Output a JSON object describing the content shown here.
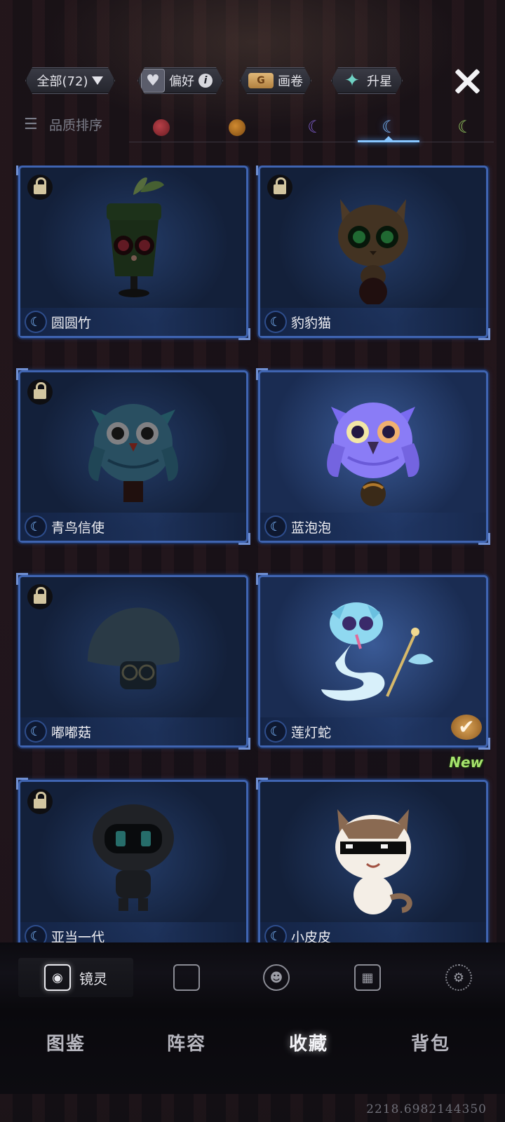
{
  "topbar": {
    "filter_label": "全部(72)",
    "preference_label": "偏好",
    "scroll_label": "画卷",
    "upgrade_label": "升星",
    "scroll_badge": "G",
    "info_badge": "i"
  },
  "quality": {
    "sort_label": "品质排序",
    "tiers": [
      "red",
      "orange",
      "purple",
      "blue",
      "green"
    ],
    "active_tier": "blue"
  },
  "cards": [
    {
      "name": "圆圆竹",
      "locked": true,
      "checked": false,
      "new": false
    },
    {
      "name": "豹豹猫",
      "locked": true,
      "checked": false,
      "new": false
    },
    {
      "name": "青鸟信使",
      "locked": true,
      "checked": false,
      "new": false
    },
    {
      "name": "蓝泡泡",
      "locked": false,
      "checked": false,
      "new": false
    },
    {
      "name": "嘟嘟菇",
      "locked": true,
      "checked": false,
      "new": false
    },
    {
      "name": "莲灯蛇",
      "locked": false,
      "checked": true,
      "new": false
    },
    {
      "name": "亚当一代",
      "locked": true,
      "checked": false,
      "new": false
    },
    {
      "name": "小皮皮",
      "locked": false,
      "checked": false,
      "new": true,
      "new_label": "New"
    }
  ],
  "subtabs": {
    "active_label": "镜灵"
  },
  "mainnav": [
    "图鉴",
    "阵容",
    "收藏",
    "背包"
  ],
  "mainnav_active": "收藏",
  "footer": {
    "coordinates": "2218.6982144350"
  },
  "colors": {
    "card_border": "#3f64b1",
    "active_tab": "#87c6ff",
    "new_tag": "#a6e36c"
  }
}
